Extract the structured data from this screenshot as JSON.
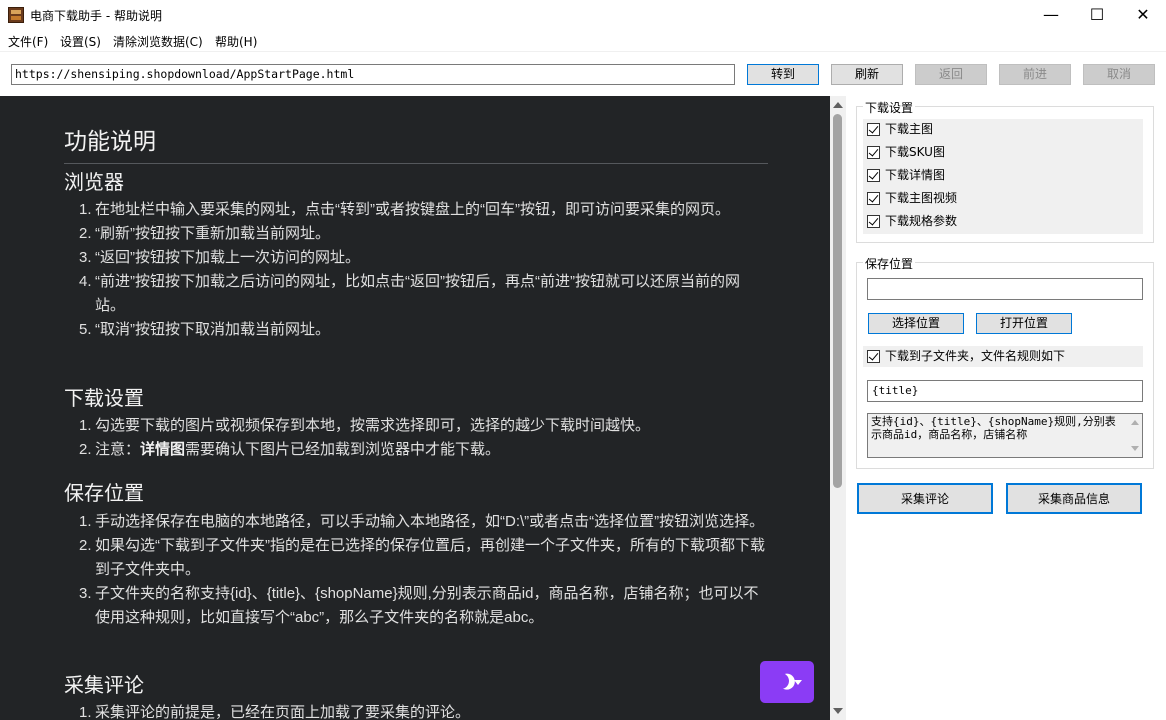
{
  "window": {
    "title": "电商下载助手 - 帮助说明",
    "minimize": "—",
    "maximize": "☐",
    "close": "✕"
  },
  "menu": [
    {
      "label": "文件(F)"
    },
    {
      "label": "设置(S)"
    },
    {
      "label": "清除浏览数据(C)"
    },
    {
      "label": "帮助(H)"
    }
  ],
  "toolbar": {
    "url": "https://shensiping.shopdownload/AppStartPage.html",
    "go": "转到",
    "refresh": "刷新",
    "back": "返回",
    "forward": "前进",
    "cancel": "取消"
  },
  "help": {
    "title": "功能说明",
    "sections": [
      {
        "heading": "浏览器",
        "items": [
          "在地址栏中输入要采集的网址，点击“转到”或者按键盘上的“回车”按钮，即可访问要采集的网页。",
          "“刷新”按钮按下重新加载当前网址。",
          "“返回”按钮按下加载上一次访问的网址。",
          "“前进”按钮按下加载之后访问的网址，比如点击“返回”按钮后，再点“前进”按钮就可以还原当前的网站。",
          "“取消”按钮按下取消加载当前网址。"
        ]
      },
      {
        "heading": "下载设置",
        "items": [
          "勾选要下载的图片或视频保存到本地，按需求选择即可，选择的越少下载时间越快。"
        ],
        "note_prefix": "注意：",
        "note_bold": "详情图",
        "note_suffix": "需要确认下图片已经加载到浏览器中才能下载。"
      },
      {
        "heading": "保存位置",
        "items": [
          "手动选择保存在电脑的本地路径，可以手动输入本地路径，如“D:\\”或者点击“选择位置”按钮浏览选择。",
          "如果勾选“下载到子文件夹”指的是在已选择的保存位置后，再创建一个子文件夹，所有的下载项都下载到子文件夹中。",
          "子文件夹的名称支持{id}、{title}、{shopName}规则,分别表示商品id，商品名称，店铺名称；也可以不使用这种规则，比如直接写个“abc”，那么子文件夹的名称就是abc。"
        ]
      },
      {
        "heading": "采集评论",
        "items": [
          "采集评论的前提是，已经在页面上加载了要采集的评论。"
        ]
      }
    ]
  },
  "download_settings": {
    "title": "下载设置",
    "options": [
      {
        "label": "下载主图",
        "checked": true
      },
      {
        "label": "下载SKU图",
        "checked": true
      },
      {
        "label": "下载详情图",
        "checked": true
      },
      {
        "label": "下载主图视频",
        "checked": true
      },
      {
        "label": "下载规格参数",
        "checked": true
      }
    ]
  },
  "save_location": {
    "title": "保存位置",
    "path_value": "",
    "choose_button": "选择位置",
    "open_button": "打开位置",
    "subfolder_label": "下载到子文件夹，文件名规则如下",
    "subfolder_checked": true,
    "rule_value": "{title}",
    "rule_help": "支持{id}、{title}、{shopName}规则,分别表示商品id，商品名称，店铺名称"
  },
  "actions": {
    "collect_reviews": "采集评论",
    "collect_product": "采集商品信息"
  },
  "colors": {
    "content_bg": "#222426",
    "theme_button": "#8b3cf5",
    "accent_border": "#0078d7"
  },
  "icons": {
    "theme_toggle": "moon-icon"
  }
}
